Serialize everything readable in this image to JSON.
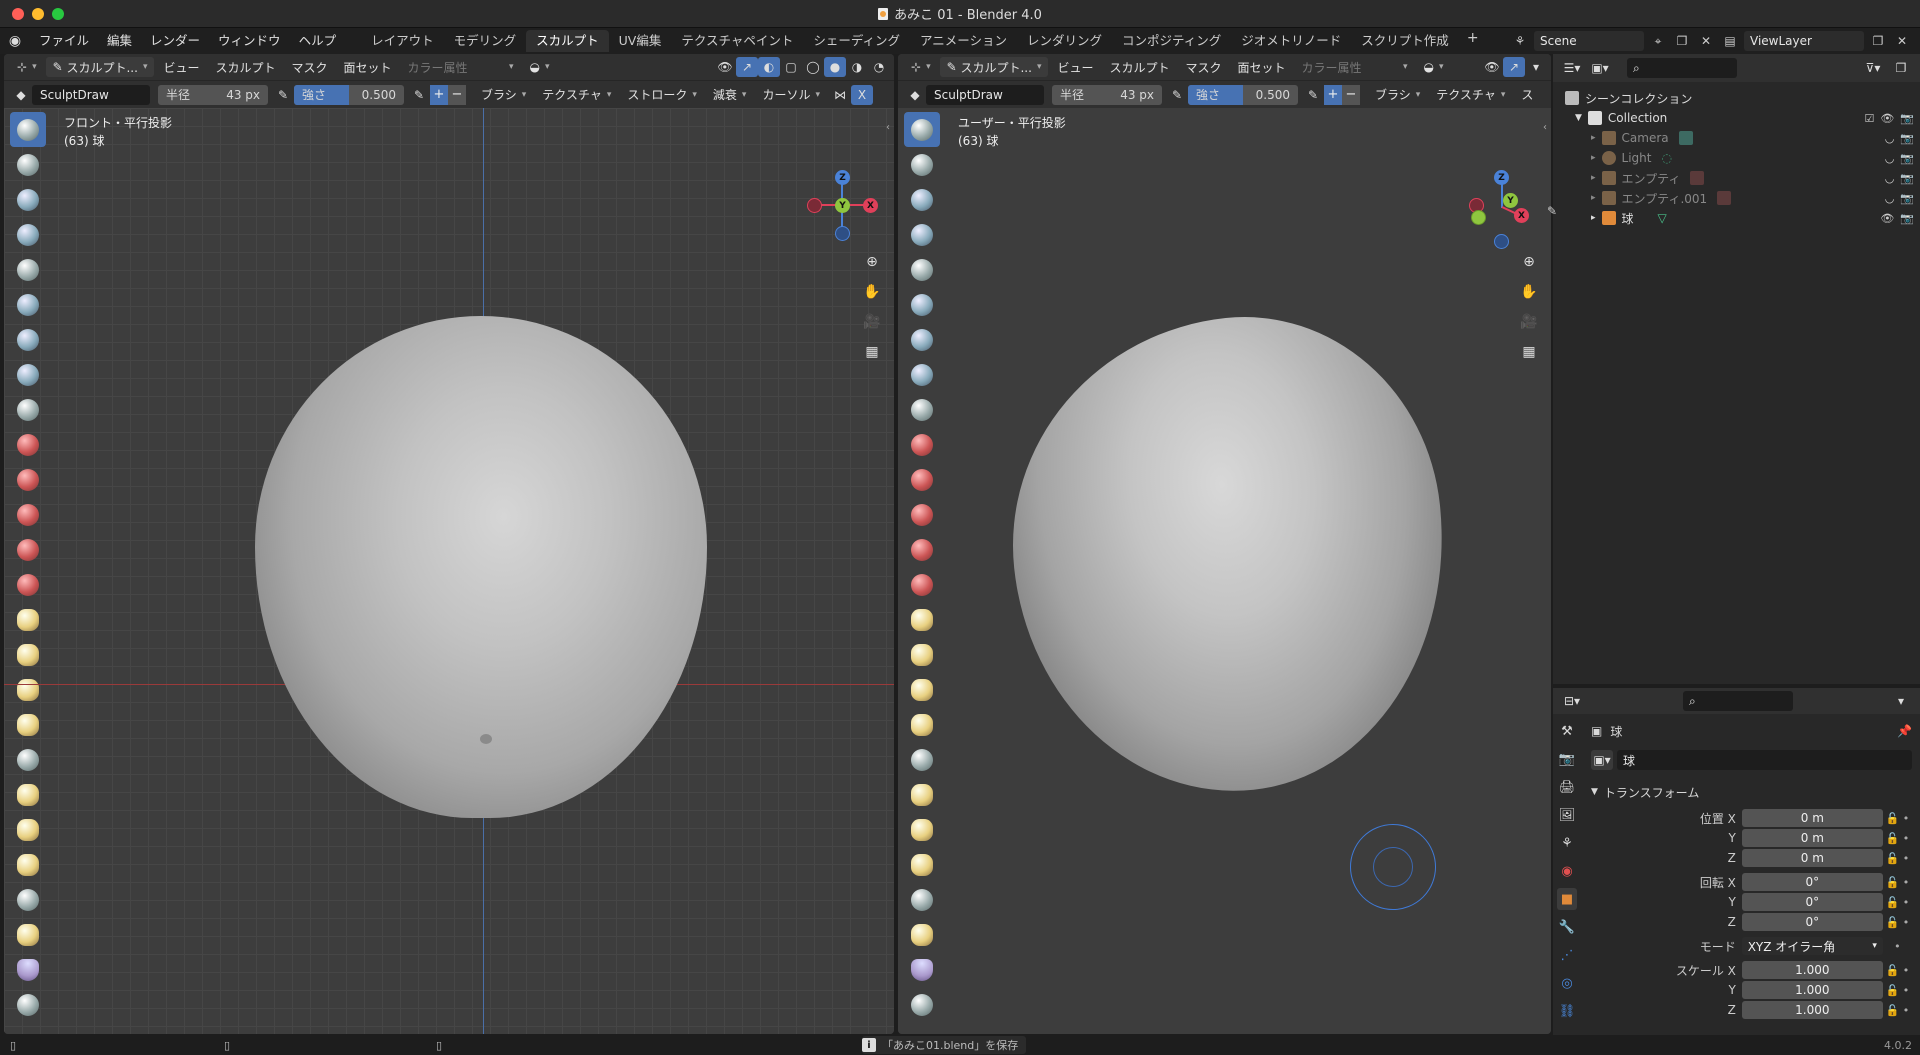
{
  "window": {
    "title": "あみこ 01 - Blender 4.0"
  },
  "menu": [
    "ファイル",
    "編集",
    "レンダー",
    "ウィンドウ",
    "ヘルプ"
  ],
  "workspaces": [
    {
      "label": "レイアウト",
      "active": false
    },
    {
      "label": "モデリング",
      "active": false
    },
    {
      "label": "スカルプト",
      "active": true
    },
    {
      "label": "UV編集",
      "active": false
    },
    {
      "label": "テクスチャペイント",
      "active": false
    },
    {
      "label": "シェーディング",
      "active": false
    },
    {
      "label": "アニメーション",
      "active": false
    },
    {
      "label": "レンダリング",
      "active": false
    },
    {
      "label": "コンポジティング",
      "active": false
    },
    {
      "label": "ジオメトリノード",
      "active": false
    },
    {
      "label": "スクリプト作成",
      "active": false
    }
  ],
  "ws_add": "+",
  "scene": {
    "name": "Scene",
    "viewlayer": "ViewLayer"
  },
  "viewport_header": {
    "mode": "スカルプト...",
    "menus": [
      "ビュー",
      "スカルプト",
      "マスク",
      "面セット"
    ],
    "color_attr": "カラー属性"
  },
  "tool_header": {
    "brush_name": "SculptDraw",
    "radius_label": "半径",
    "radius_value": "43 px",
    "strength_label": "強さ",
    "strength_value": "0.500",
    "strength_fraction": 0.5,
    "plus": "+",
    "minus": "−",
    "dropdowns_left": [
      "ブラシ",
      "テクスチャ",
      "ストローク",
      "減衰",
      "カーソル"
    ],
    "dropdowns_right": [
      "ブラシ",
      "テクスチャ",
      "ス"
    ],
    "extra": "X"
  },
  "viewport_left": {
    "view_name": "フロント・平行投影",
    "object": "(63) 球"
  },
  "viewport_right": {
    "view_name": "ユーザー・平行投影",
    "object": "(63) 球"
  },
  "gizmo": {
    "z": "Z",
    "y": "Y",
    "x": "X"
  },
  "outliner": {
    "root": "シーンコレクション",
    "collection": "Collection",
    "items": [
      {
        "label": "Camera",
        "dim": true,
        "color": "#9a7a55"
      },
      {
        "label": "Light",
        "dim": true,
        "color": "#9a7a55"
      },
      {
        "label": "エンプティ",
        "dim": true,
        "color": "#9a7a55"
      },
      {
        "label": "エンプティ.001",
        "dim": true,
        "color": "#9a7a55"
      },
      {
        "label": "球",
        "dim": false,
        "color": "#e08a3a"
      }
    ]
  },
  "properties": {
    "object_name": "球",
    "data_name": "球",
    "section": "トランスフォーム",
    "rows": [
      {
        "label": "位置 X",
        "value": "0 m"
      },
      {
        "label": "Y",
        "value": "0 m"
      },
      {
        "label": "Z",
        "value": "0 m"
      },
      {
        "label": "回転 X",
        "value": "0°"
      },
      {
        "label": "Y",
        "value": "0°"
      },
      {
        "label": "Z",
        "value": "0°"
      },
      {
        "label": "モード",
        "value": "XYZ オイラー角"
      },
      {
        "label": "スケール X",
        "value": "1.000"
      },
      {
        "label": "Y",
        "value": "1.000"
      },
      {
        "label": "Z",
        "value": "1.000"
      }
    ]
  },
  "status": {
    "message": "「あみこ01.blend」を保存",
    "version": "4.0.2"
  },
  "colors": {
    "accent": "#4772b3",
    "x_axis": "#e0405a",
    "y_axis": "#8fc63f",
    "z_axis": "#4a82d8"
  }
}
